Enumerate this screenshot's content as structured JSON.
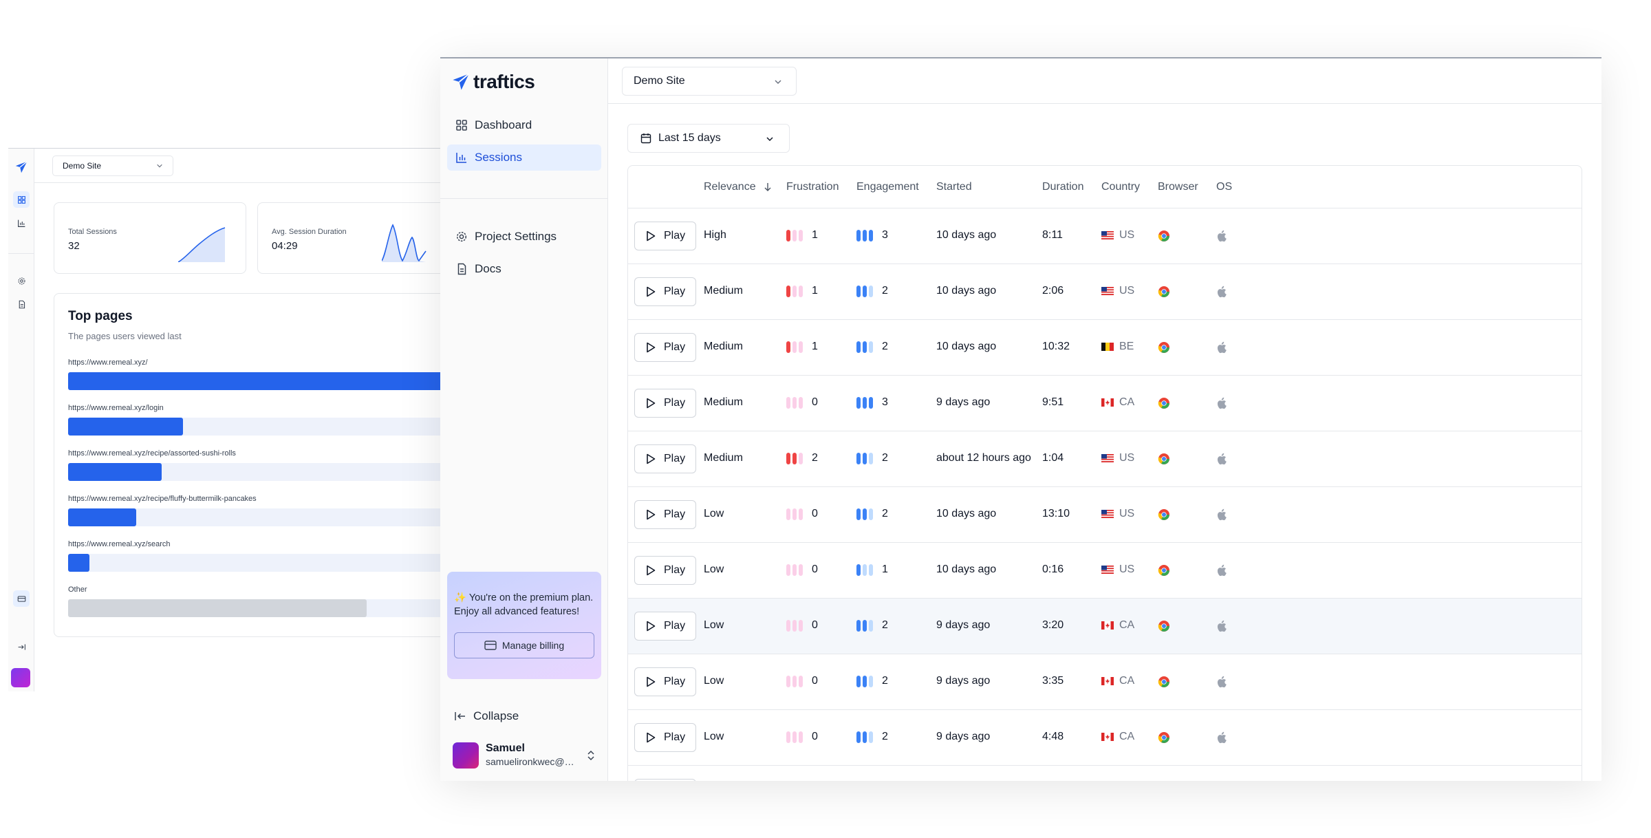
{
  "colors": {
    "accent": "#2563eb",
    "frustration_on": "#ef4444",
    "frustration_off": "#fbcfe8",
    "engagement_on": "#3b82f6",
    "engagement_off": "#bfdbfe"
  },
  "back": {
    "site_select": "Demo Site",
    "stats": [
      {
        "label": "Total Sessions",
        "value": "32"
      },
      {
        "label": "Avg. Session Duration",
        "value": "04:29"
      }
    ],
    "top_pages": {
      "title": "Top pages",
      "subtitle": "The pages users viewed last",
      "rows": [
        {
          "url": "https://www.remeal.xyz/",
          "share": 1.0
        },
        {
          "url": "https://www.remeal.xyz/login",
          "share": 0.27
        },
        {
          "url": "https://www.remeal.xyz/recipe/assorted-sushi-rolls",
          "share": 0.22
        },
        {
          "url": "https://www.remeal.xyz/recipe/fluffy-buttermilk-pancakes",
          "share": 0.16
        },
        {
          "url": "https://www.remeal.xyz/search",
          "share": 0.05
        },
        {
          "url": "Other",
          "share": 0.7
        }
      ]
    }
  },
  "sidebar": {
    "brand": "traftics",
    "nav": [
      {
        "label": "Dashboard",
        "icon": "grid-icon"
      },
      {
        "label": "Sessions",
        "icon": "bar-chart-icon",
        "active": true
      }
    ],
    "nav2": [
      {
        "label": "Project Settings",
        "icon": "gear-icon"
      },
      {
        "label": "Docs",
        "icon": "document-icon"
      }
    ],
    "premium_message": "✨ You're on the premium plan. Enjoy all advanced features!",
    "billing_label": "Manage billing",
    "collapse_label": "Collapse",
    "user_name": "Samuel",
    "user_email": "samuelironkwec@gmail.com"
  },
  "main": {
    "site_select": "Demo Site",
    "date_range": "Last 15 days",
    "columns": [
      "Relevance",
      "Frustration",
      "Engagement",
      "Started",
      "Duration",
      "Country",
      "Browser",
      "OS"
    ],
    "play_label": "Play",
    "rows": [
      {
        "relevance": "High",
        "frustration": 1,
        "engagement": 3,
        "started": "10 days ago",
        "duration": "8:11",
        "country": "US"
      },
      {
        "relevance": "Medium",
        "frustration": 1,
        "engagement": 2,
        "started": "10 days ago",
        "duration": "2:06",
        "country": "US"
      },
      {
        "relevance": "Medium",
        "frustration": 1,
        "engagement": 2,
        "started": "10 days ago",
        "duration": "10:32",
        "country": "BE"
      },
      {
        "relevance": "Medium",
        "frustration": 0,
        "engagement": 3,
        "started": "9 days ago",
        "duration": "9:51",
        "country": "CA"
      },
      {
        "relevance": "Medium",
        "frustration": 2,
        "engagement": 2,
        "started": "about 12 hours ago",
        "duration": "1:04",
        "country": "US"
      },
      {
        "relevance": "Low",
        "frustration": 0,
        "engagement": 2,
        "started": "10 days ago",
        "duration": "13:10",
        "country": "US"
      },
      {
        "relevance": "Low",
        "frustration": 0,
        "engagement": 1,
        "started": "10 days ago",
        "duration": "0:16",
        "country": "US"
      },
      {
        "relevance": "Low",
        "frustration": 0,
        "engagement": 2,
        "started": "9 days ago",
        "duration": "3:20",
        "country": "CA",
        "highlighted": true
      },
      {
        "relevance": "Low",
        "frustration": 0,
        "engagement": 2,
        "started": "9 days ago",
        "duration": "3:35",
        "country": "CA"
      },
      {
        "relevance": "Low",
        "frustration": 0,
        "engagement": 2,
        "started": "9 days ago",
        "duration": "4:48",
        "country": "CA"
      }
    ]
  }
}
